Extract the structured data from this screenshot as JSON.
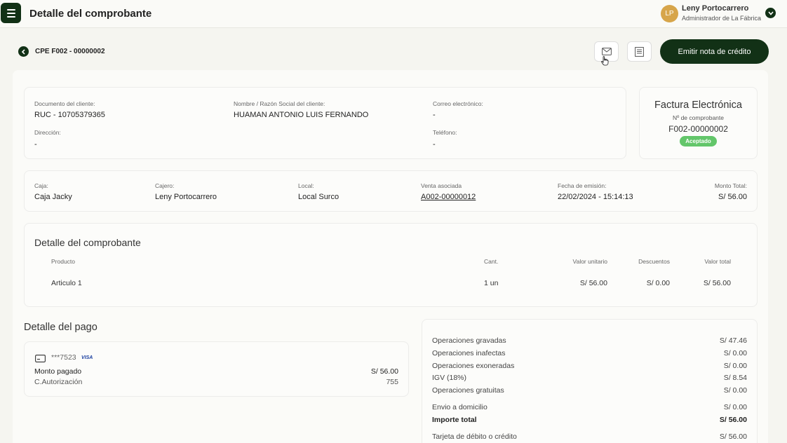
{
  "header": {
    "title": "Detalle del comprobante",
    "user_initials": "LP",
    "user_name": "Leny Portocarrero",
    "user_role": "Administrador de La Fábrica"
  },
  "toolbar": {
    "doc_id": "CPE F002 - 00000002",
    "primary_button": "Emitir nota de crédito"
  },
  "client": {
    "doc_label": "Documento del cliente:",
    "doc_value": "RUC - 10705379365",
    "name_label": "Nombre / Razón Social del cliente:",
    "name_value": "HUAMAN ANTONIO LUIS FERNANDO",
    "email_label": "Correo electrónico:",
    "email_value": "-",
    "address_label": "Dirección:",
    "address_value": "-",
    "phone_label": "Teléfono:",
    "phone_value": "-"
  },
  "invoice": {
    "type": "Factura Electrónica",
    "number_label": "Nº de comprobante",
    "number": "F002-00000002",
    "status": "Aceptado"
  },
  "info": {
    "caja_label": "Caja:",
    "caja": "Caja Jacky",
    "cajero_label": "Cajero:",
    "cajero": "Leny Portocarrero",
    "local_label": "Local:",
    "local": "Local Surco",
    "venta_label": "Venta asociada",
    "venta": "A002-00000012",
    "fecha_label": "Fecha de emisión:",
    "fecha": "22/02/2024 - 15:14:13",
    "monto_label": "Monto Total:",
    "monto": "S/ 56.00"
  },
  "detail": {
    "title": "Detalle del comprobante",
    "columns": [
      "Producto",
      "Cant.",
      "Valor unitario",
      "Descuentos",
      "Valor total"
    ],
    "rows": [
      [
        "Articulo 1",
        "1 un",
        "S/ 56.00",
        "S/ 0.00",
        "S/ 56.00"
      ]
    ]
  },
  "payment": {
    "title": "Detalle del pago",
    "card_masked": "***7523",
    "card_brand": "VISA",
    "paid_label": "Monto pagado",
    "paid_value": "S/ 56.00",
    "auth_label": "C.Autorización",
    "auth_value": "755"
  },
  "summary": {
    "rows": [
      {
        "label": "Operaciones gravadas",
        "value": "S/ 47.46"
      },
      {
        "label": "Operaciones inafectas",
        "value": "S/ 0.00"
      },
      {
        "label": "Operaciones exoneradas",
        "value": "S/ 0.00"
      },
      {
        "label": "IGV (18%)",
        "value": "S/ 8.54"
      },
      {
        "label": "Operaciones gratuitas",
        "value": "S/ 0.00"
      },
      {
        "label": "Envio a domicilio",
        "value": "S/ 0.00"
      },
      {
        "label": "Importe total",
        "value": "S/ 56.00"
      },
      {
        "label": "Tarjeta de débito o crédito",
        "value": "S/ 56.00"
      }
    ]
  },
  "colors": {
    "primary": "#123116",
    "accent_avatar": "#d7a54a",
    "status_green": "#63c66a"
  },
  "icons": [
    "menu-icon",
    "chevron-down-icon",
    "back-arrow-icon",
    "mail-icon",
    "receipt-icon",
    "credit-card-icon",
    "hand-cursor-icon"
  ]
}
